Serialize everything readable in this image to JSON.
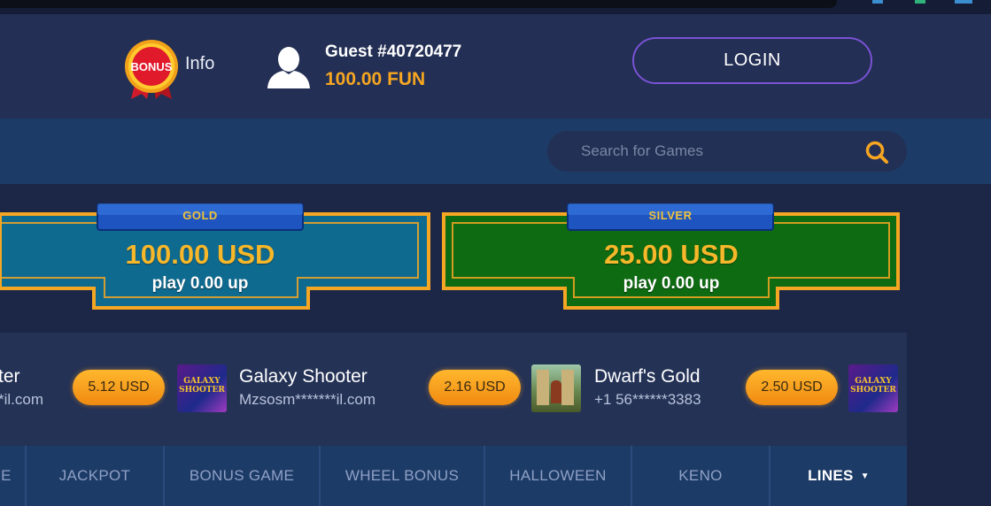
{
  "header": {
    "bonus_badge_text": "BONUS",
    "bonus_info_label": "Info",
    "guest_name": "Guest #40720477",
    "guest_balance": "100.00 FUN",
    "login_label": "LOGIN"
  },
  "search": {
    "placeholder": "Search for Games"
  },
  "jackpots": [
    {
      "label": "GOLD",
      "amount": "100.00 USD",
      "play": "play 0.00 up",
      "color": "#0f6a8f"
    },
    {
      "label": "SILVER",
      "amount": "25.00 USD",
      "play": "play 0.00 up",
      "color": "#0e6b12"
    }
  ],
  "winners": [
    {
      "amount": "",
      "game": "ter",
      "user": "*il.com"
    },
    {
      "amount": "5.12 USD",
      "game": "Galaxy Shooter",
      "user": "Mzsosm*******il.com",
      "thumb": "galaxy"
    },
    {
      "amount": "2.16 USD",
      "game": "Dwarf's Gold",
      "user": "+1 56******3383",
      "thumb": "dwarf"
    },
    {
      "amount": "2.50 USD",
      "game": "",
      "user": "",
      "thumb": "galaxy"
    }
  ],
  "thumb_text": {
    "galaxy": "GALAXY SHOOTER"
  },
  "nav": {
    "items": [
      {
        "label": "E"
      },
      {
        "label": "JACKPOT"
      },
      {
        "label": "BONUS GAME"
      },
      {
        "label": "WHEEL BONUS"
      },
      {
        "label": "HALLOWEEN"
      },
      {
        "label": "KENO"
      },
      {
        "label": "LINES"
      }
    ]
  },
  "colors": {
    "accent_orange": "#f6a621",
    "login_border": "#7a52d4",
    "header_bg": "#232f54"
  }
}
